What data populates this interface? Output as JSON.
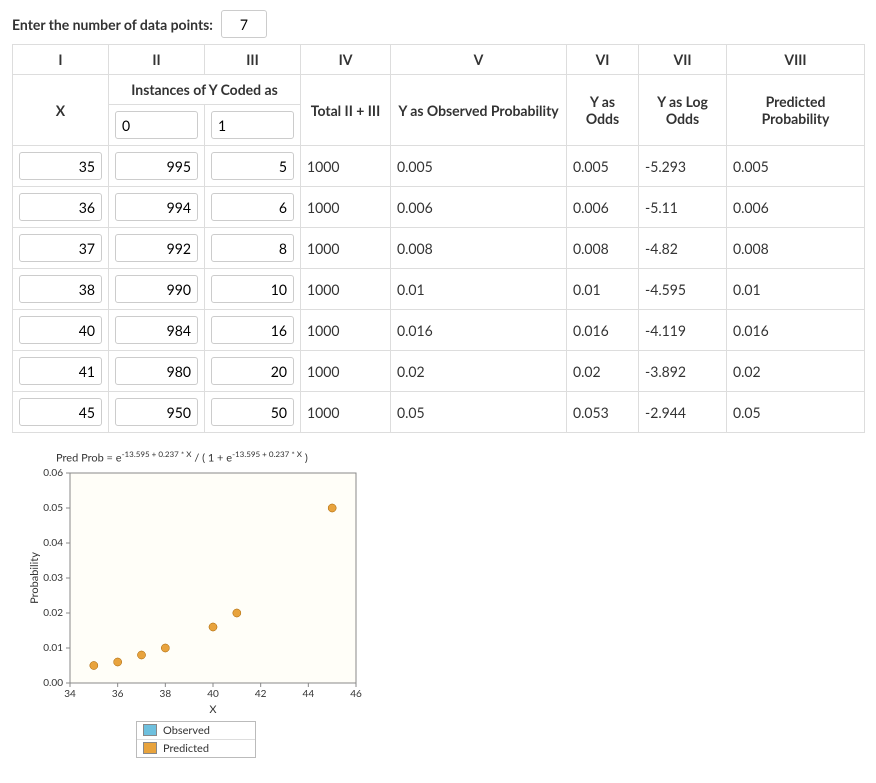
{
  "prompt": {
    "label": "Enter the number of data points:",
    "value": "7"
  },
  "columns": [
    "I",
    "II",
    "III",
    "IV",
    "V",
    "VI",
    "VII",
    "VIII"
  ],
  "sub": {
    "x": "X",
    "coded": "Instances of Y Coded as",
    "code0": "0",
    "code1": "1",
    "total": "Total II + III",
    "obsprob": "Y as Observed Probability",
    "odds": "Y as Odds",
    "logodds": "Y as Log Odds",
    "predprob": "Predicted Probability"
  },
  "rows": [
    {
      "x": "35",
      "c0": "995",
      "c1": "5",
      "total": "1000",
      "obs": "0.005",
      "odds": "0.005",
      "log": "-5.293",
      "pred": "0.005"
    },
    {
      "x": "36",
      "c0": "994",
      "c1": "6",
      "total": "1000",
      "obs": "0.006",
      "odds": "0.006",
      "log": "-5.11",
      "pred": "0.006"
    },
    {
      "x": "37",
      "c0": "992",
      "c1": "8",
      "total": "1000",
      "obs": "0.008",
      "odds": "0.008",
      "log": "-4.82",
      "pred": "0.008"
    },
    {
      "x": "38",
      "c0": "990",
      "c1": "10",
      "total": "1000",
      "obs": "0.01",
      "odds": "0.01",
      "log": "-4.595",
      "pred": "0.01"
    },
    {
      "x": "40",
      "c0": "984",
      "c1": "16",
      "total": "1000",
      "obs": "0.016",
      "odds": "0.016",
      "log": "-4.119",
      "pred": "0.016"
    },
    {
      "x": "41",
      "c0": "980",
      "c1": "20",
      "total": "1000",
      "obs": "0.02",
      "odds": "0.02",
      "log": "-3.892",
      "pred": "0.02"
    },
    {
      "x": "45",
      "c0": "950",
      "c1": "50",
      "total": "1000",
      "obs": "0.05",
      "odds": "0.053",
      "log": "-2.944",
      "pred": "0.05"
    }
  ],
  "chart_data": {
    "type": "scatter",
    "title_html": "Pred Prob = e<sup>-13.595 + 0.237 * X</sup> / ( 1 + e<sup>-13.595 + 0.237 * X</sup> )",
    "xlabel": "X",
    "ylabel": "Probability",
    "xlim": [
      34,
      46
    ],
    "ylim": [
      0,
      0.06
    ],
    "xticks": [
      34,
      36,
      38,
      40,
      42,
      44,
      46
    ],
    "yticks": [
      0.0,
      0.01,
      0.02,
      0.03,
      0.04,
      0.05,
      0.06
    ],
    "series": [
      {
        "name": "Observed",
        "color": "#6ec0de",
        "points": [
          [
            35,
            0.005
          ],
          [
            36,
            0.006
          ],
          [
            37,
            0.008
          ],
          [
            38,
            0.01
          ],
          [
            40,
            0.016
          ],
          [
            41,
            0.02
          ],
          [
            45,
            0.05
          ]
        ]
      },
      {
        "name": "Predicted",
        "color": "#e8a33d",
        "points": [
          [
            35,
            0.005
          ],
          [
            36,
            0.006
          ],
          [
            37,
            0.008
          ],
          [
            38,
            0.01
          ],
          [
            40,
            0.016
          ],
          [
            41,
            0.02
          ],
          [
            45,
            0.05
          ]
        ]
      }
    ],
    "legend": [
      "Observed",
      "Predicted"
    ]
  }
}
